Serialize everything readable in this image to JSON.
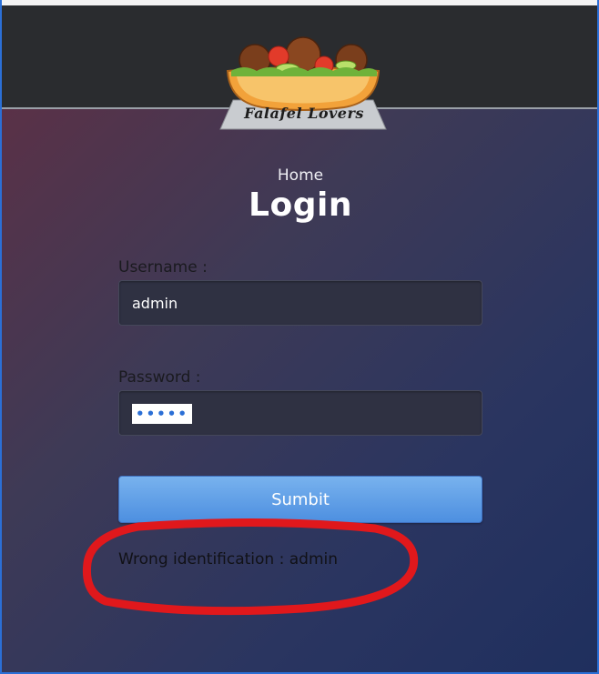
{
  "brand": {
    "logo_text": "Falafel Lovers"
  },
  "breadcrumb": "Home",
  "page_title": "Login",
  "form": {
    "username_label": "Username :",
    "username_value": "admin",
    "password_label": "Password :",
    "password_mask": "•••••",
    "submit_label": "Sumbit"
  },
  "error": {
    "message": "Wrong identification : admin"
  },
  "colors": {
    "header_bg": "#2a2c2f",
    "button_blue": "#4d8fe0",
    "annotation_red": "#e0181c"
  },
  "icons": [
    "falafel-bowl-logo"
  ]
}
